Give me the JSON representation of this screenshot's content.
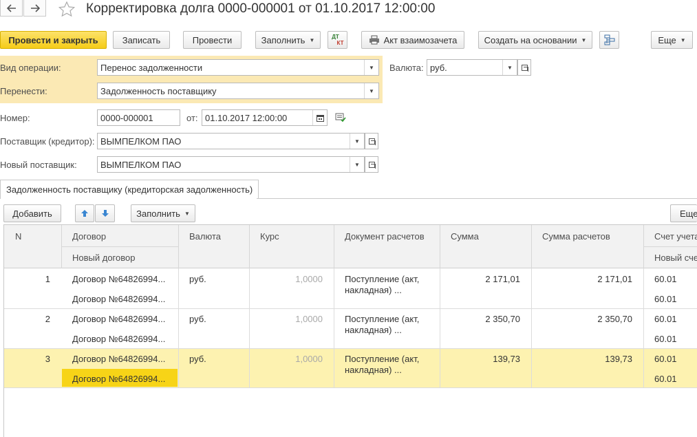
{
  "window": {
    "title": "Корректировка долга 0000-000001 от 01.10.2017 12:00:00",
    "back_icon": "arrow-left-icon",
    "forward_icon": "arrow-right-icon",
    "favorite_icon": "star-icon"
  },
  "toolbar": {
    "post_close": "Провести и закрыть",
    "save": "Записать",
    "post": "Провести",
    "fill": "Заполнить",
    "dt_kt_top": "ДТ",
    "dt_kt_bottom": "КТ",
    "act": "Акт взаимозачета",
    "create_based": "Создать на основании",
    "more": "Еще"
  },
  "form": {
    "operation_label": "Вид операции:",
    "operation_value": "Перенос задолженности",
    "transfer_label": "Перенести:",
    "transfer_value": "Задолженность поставщику",
    "currency_label": "Валюта:",
    "currency_value": "руб.",
    "number_label": "Номер:",
    "number_value": "0000-000001",
    "date_label": "от:",
    "date_value": "01.10.2017 12:00:00",
    "supplier_label": "Поставщик (кредитор):",
    "supplier_value": "ВЫМПЕЛКОМ ПАО",
    "new_supplier_label": "Новый поставщик:",
    "new_supplier_value": "ВЫМПЕЛКОМ ПАО"
  },
  "tabs": [
    {
      "label": "Задолженность поставщику (кредиторская задолженность)"
    }
  ],
  "table_toolbar": {
    "add": "Добавить",
    "fill": "Заполнить",
    "more": "Еще"
  },
  "table": {
    "headers": {
      "n": "N",
      "contract": "Договор",
      "new_contract": "Новый договор",
      "currency": "Валюта",
      "rate": "Курс",
      "doc": "Документ расчетов",
      "sum": "Сумма",
      "sum_calc": "Сумма расчетов",
      "account": "Счет учета",
      "new_account": "Новый счет"
    },
    "rows": [
      {
        "n": "1",
        "contract": "Договор №64826994...",
        "new_contract": "Договор №64826994...",
        "currency": "руб.",
        "rate": "1,0000",
        "doc_line1": "Поступление (акт,",
        "doc_line2": "накладная) ...",
        "sum": "2 171,01",
        "sum_calc": "2 171,01",
        "account": "60.01",
        "new_account": "60.01"
      },
      {
        "n": "2",
        "contract": "Договор №64826994...",
        "new_contract": "Договор №64826994...",
        "currency": "руб.",
        "rate": "1,0000",
        "doc_line1": "Поступление (акт,",
        "doc_line2": "накладная) ...",
        "sum": "2 350,70",
        "sum_calc": "2 350,70",
        "account": "60.01",
        "new_account": "60.01"
      },
      {
        "n": "3",
        "contract": "Договор №64826994...",
        "new_contract": "Договор №64826994...",
        "currency": "руб.",
        "rate": "1,0000",
        "doc_line1": "Поступление (акт,",
        "doc_line2": "накладная) ...",
        "sum": "139,73",
        "sum_calc": "139,73",
        "account": "60.01",
        "new_account": "60.01"
      }
    ]
  }
}
